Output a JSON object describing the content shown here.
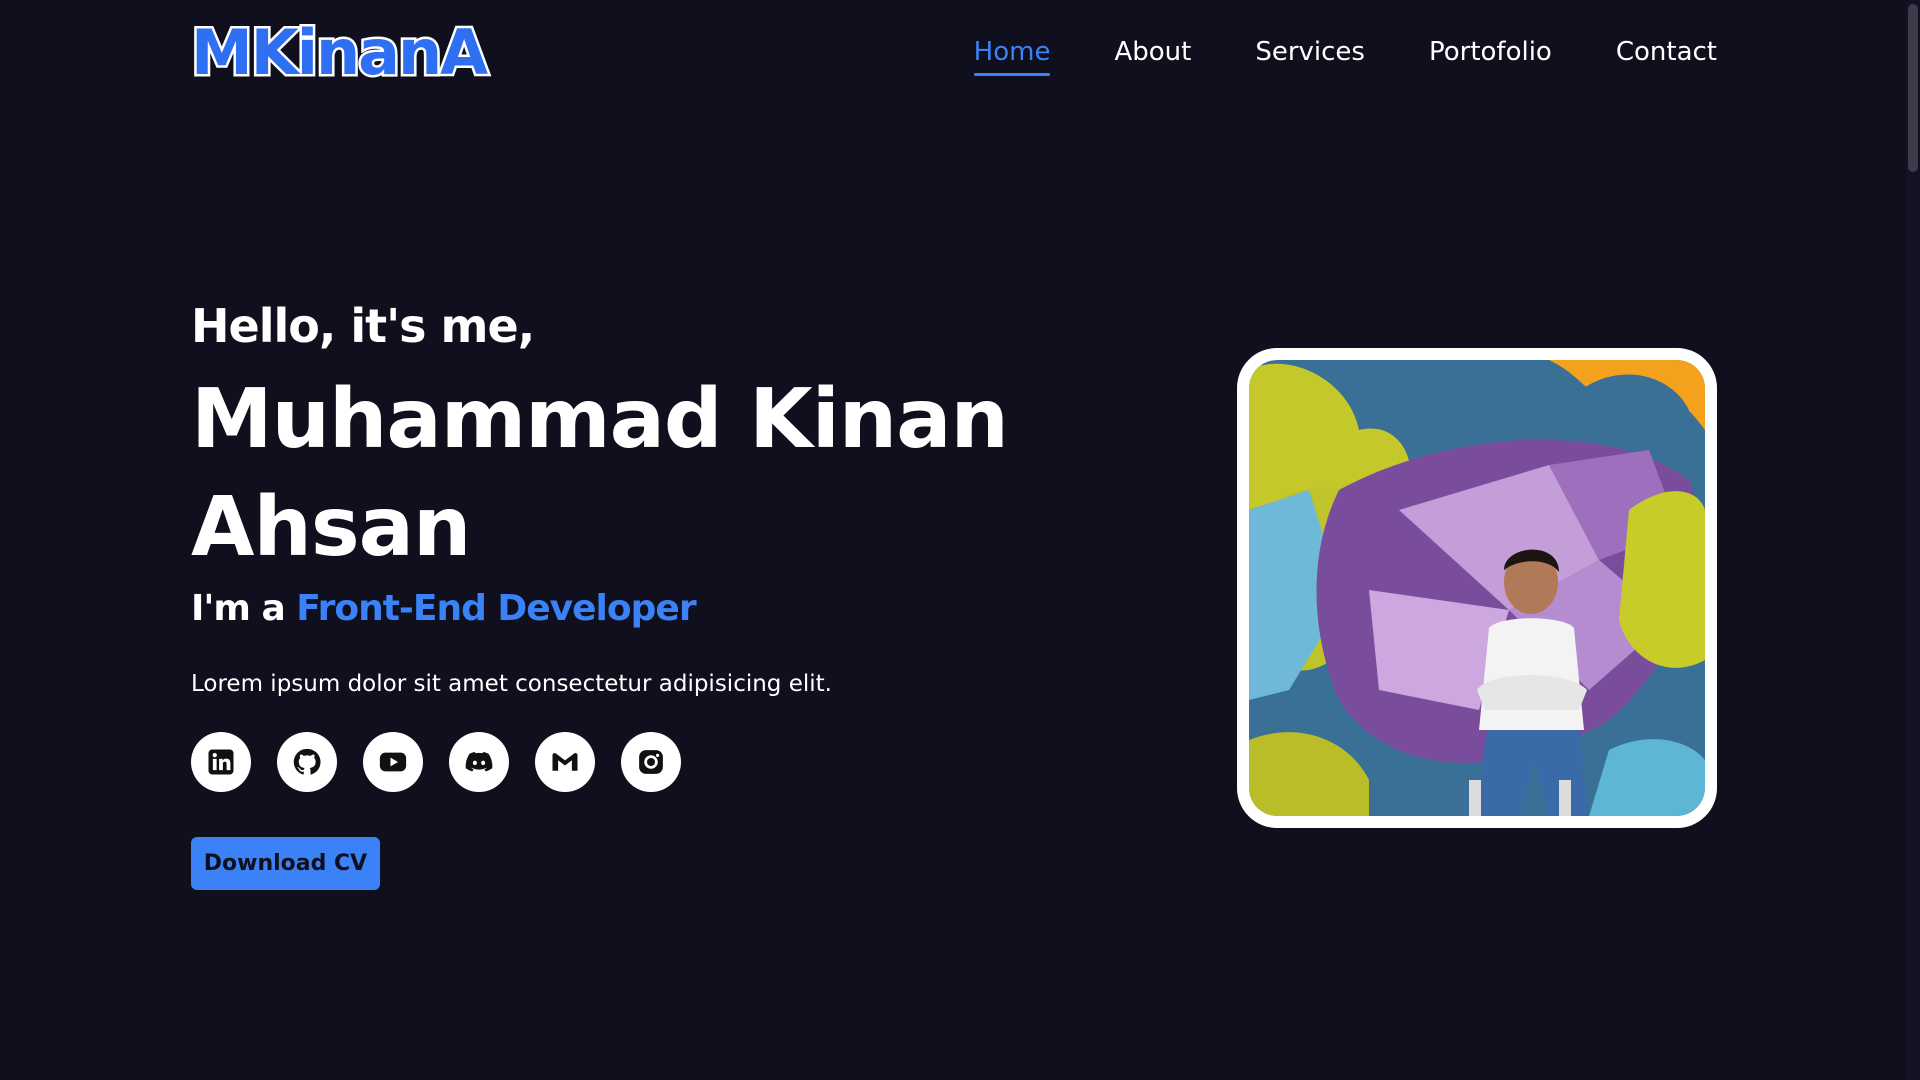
{
  "header": {
    "logo_text": "MKinanA",
    "nav": [
      {
        "label": "Home",
        "active": true
      },
      {
        "label": "About",
        "active": false
      },
      {
        "label": "Services",
        "active": false
      },
      {
        "label": "Portofolio",
        "active": false
      },
      {
        "label": "Contact",
        "active": false
      }
    ]
  },
  "hero": {
    "greeting": "Hello, it's me,",
    "name": "Muhammad Kinan Ahsan",
    "role_prefix": "I'm a ",
    "role_highlight": "Front-End Developer",
    "description": "Lorem ipsum dolor sit amet consectetur adipisicing elit.",
    "socials": [
      {
        "icon": "linkedin-icon"
      },
      {
        "icon": "github-icon"
      },
      {
        "icon": "youtube-icon"
      },
      {
        "icon": "discord-icon"
      },
      {
        "icon": "gmail-icon"
      },
      {
        "icon": "instagram-icon"
      }
    ],
    "cv_button_label": "Download CV",
    "photo_alt": "portrait"
  },
  "colors": {
    "background": "#0f0f1e",
    "accent": "#3b82f6",
    "text": "#ffffff"
  }
}
